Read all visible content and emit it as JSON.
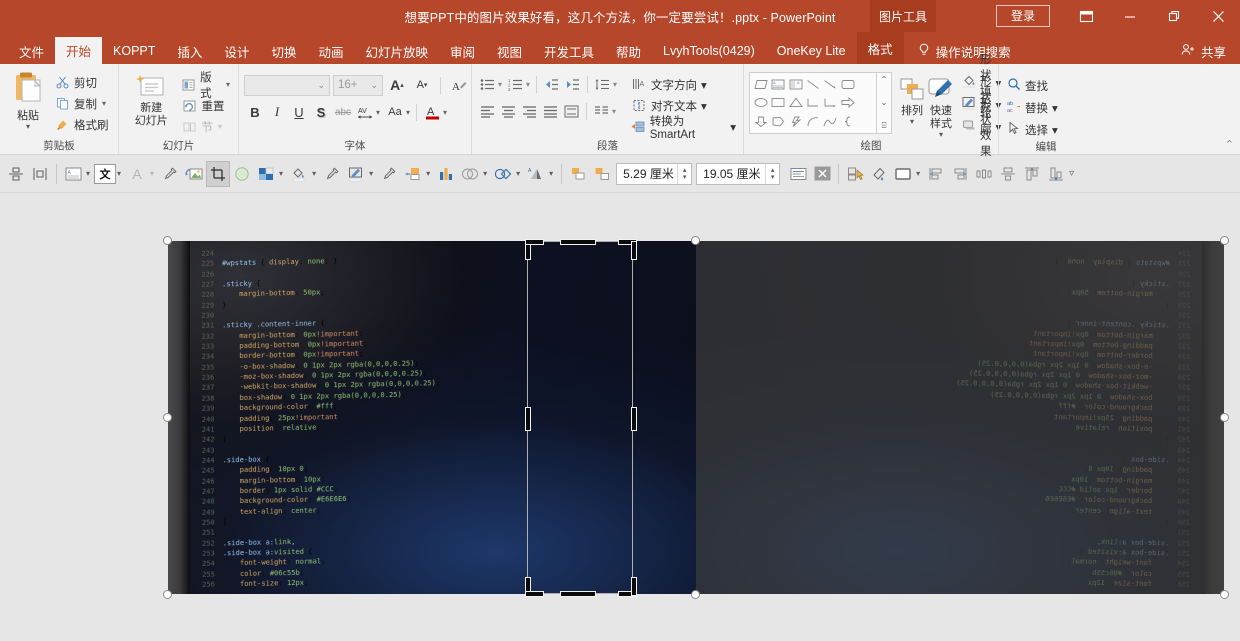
{
  "titlebar": {
    "document_title": "想要PPT中的图片效果好看，这几个方法，你一定要尝试！.pptx  -  PowerPoint",
    "picture_tools_label": "图片工具",
    "signin_label": "登录",
    "ribbon_display_icon": "ribbon-display-options-icon",
    "minimize_label": "—",
    "restore_label": "❐",
    "close_label": "✕"
  },
  "tabs": [
    {
      "label": "文件",
      "state": "normal"
    },
    {
      "label": "开始",
      "state": "active"
    },
    {
      "label": "KOPPT",
      "state": "normal"
    },
    {
      "label": "插入",
      "state": "normal"
    },
    {
      "label": "设计",
      "state": "normal"
    },
    {
      "label": "切换",
      "state": "normal"
    },
    {
      "label": "动画",
      "state": "normal"
    },
    {
      "label": "幻灯片放映",
      "state": "normal"
    },
    {
      "label": "审阅",
      "state": "normal"
    },
    {
      "label": "视图",
      "state": "normal"
    },
    {
      "label": "开发工具",
      "state": "normal"
    },
    {
      "label": "帮助",
      "state": "normal"
    },
    {
      "label": "LvyhTools(0429)",
      "state": "normal"
    },
    {
      "label": "OneKey Lite",
      "state": "normal"
    },
    {
      "label": "格式",
      "state": "contextual"
    }
  ],
  "tellme": {
    "placeholder": "操作说明搜索",
    "icon": "lightbulb-icon"
  },
  "share": {
    "label": "共享",
    "icon": "share-person-icon"
  },
  "ribbon": {
    "groups": [
      {
        "name": "clipboard",
        "title": "剪贴板",
        "paste": {
          "label": "粘贴",
          "icon": "paste-icon"
        },
        "items": [
          {
            "label": "剪切",
            "icon": "scissors-icon",
            "has_dropdown": false
          },
          {
            "label": "复制",
            "icon": "copy-icon",
            "has_dropdown": true
          },
          {
            "label": "格式刷",
            "icon": "format-painter-icon",
            "has_dropdown": false
          }
        ]
      },
      {
        "name": "slides",
        "title": "幻灯片",
        "new_slide": {
          "label": "新建\n幻灯片",
          "icon": "new-slide-icon"
        },
        "items": [
          {
            "label": "版式",
            "icon": "layout-icon",
            "has_dropdown": true,
            "disabled": false
          },
          {
            "label": "重置",
            "icon": "reset-icon",
            "has_dropdown": false,
            "disabled": false
          },
          {
            "label": "节",
            "icon": "section-icon",
            "has_dropdown": true,
            "disabled": true
          }
        ]
      },
      {
        "name": "font",
        "title": "字体",
        "font_name_value": "",
        "font_size_value": "16+",
        "buttons_row1": [
          "grow-font-icon",
          "shrink-font-icon",
          "clear-formatting-icon"
        ],
        "buttons_row2": [
          "bold-icon",
          "italic-icon",
          "underline-icon",
          "shadow-icon",
          "strikethrough-icon",
          "character-spacing-icon",
          "change-case-icon",
          "font-color-icon"
        ]
      },
      {
        "name": "paragraph",
        "title": "段落",
        "row1_icons": [
          "bullets-icon",
          "numbering-icon",
          "decrease-indent-icon",
          "increase-indent-icon",
          "line-spacing-icon"
        ],
        "row2_icons": [
          "align-left-icon",
          "align-center-icon",
          "align-right-icon",
          "justify-icon",
          "columns-icon",
          "text-direction-list-icon"
        ],
        "side_items": [
          {
            "label": "文字方向",
            "icon": "text-direction-icon",
            "has_dropdown": true
          },
          {
            "label": "对齐文本",
            "icon": "align-text-icon",
            "has_dropdown": true
          },
          {
            "label": "转换为 SmartArt",
            "icon": "smartart-icon",
            "has_dropdown": true
          }
        ]
      },
      {
        "name": "drawing",
        "title": "绘图",
        "shapes_gallery_icon": "shapes-gallery",
        "arrange": {
          "label": "排列",
          "icon": "arrange-icon"
        },
        "quick_styles": {
          "label": "快速样式",
          "icon": "quick-styles-icon"
        },
        "side_items": [
          {
            "label": "形状填充",
            "icon": "shape-fill-icon",
            "has_dropdown": true
          },
          {
            "label": "形状轮廓",
            "icon": "shape-outline-icon",
            "has_dropdown": true
          },
          {
            "label": "形状效果",
            "icon": "shape-effects-icon",
            "has_dropdown": true
          }
        ]
      },
      {
        "name": "editing",
        "title": "编辑",
        "items": [
          {
            "label": "查找",
            "icon": "search-icon",
            "has_dropdown": false
          },
          {
            "label": "替换",
            "icon": "replace-icon",
            "has_dropdown": true
          },
          {
            "label": "选择",
            "icon": "select-icon",
            "has_dropdown": true
          }
        ]
      }
    ],
    "collapse_icon": "ribbon-collapse-icon"
  },
  "quick_toolbar": {
    "items": [
      {
        "icon": "align-object-icon",
        "type": "button"
      },
      {
        "icon": "distribute-object-icon",
        "type": "button"
      },
      {
        "icon": "text-box-icon",
        "type": "split"
      },
      {
        "icon": "text-direction-box-icon",
        "type": "split",
        "selected_box": true
      },
      {
        "icon": "font-color-a-icon",
        "type": "split",
        "disabled": true
      },
      {
        "icon": "eyedropper-font-icon",
        "type": "button"
      },
      {
        "icon": "change-picture-icon",
        "type": "button"
      },
      {
        "icon": "crop-icon",
        "type": "button",
        "active": true
      },
      {
        "icon": "shape-circle-icon",
        "type": "button"
      },
      {
        "icon": "picture-styles-icon",
        "type": "split"
      },
      {
        "icon": "shape-fill-bucket-icon",
        "type": "split"
      },
      {
        "icon": "eyedropper-fill-icon",
        "type": "button"
      },
      {
        "icon": "shape-outline-pen-icon",
        "type": "split"
      },
      {
        "icon": "eyedropper-outline-icon",
        "type": "button"
      },
      {
        "icon": "bring-forward-icon",
        "type": "split"
      },
      {
        "icon": "chart-icon",
        "type": "button"
      },
      {
        "icon": "merge-shapes-icon",
        "type": "split"
      },
      {
        "icon": "shape-union-icon",
        "type": "split"
      },
      {
        "icon": "shape-effects-3d-icon",
        "type": "split"
      }
    ],
    "size_height": {
      "value": "5.29 厘米",
      "name": "shape-height"
    },
    "size_width": {
      "value": "19.05 厘米",
      "name": "shape-width"
    },
    "items_right": [
      {
        "icon": "text-align-box-icon",
        "type": "button"
      },
      {
        "icon": "close-x-icon",
        "type": "button",
        "dark": true
      },
      {
        "icon": "selection-pane-icon",
        "type": "button"
      },
      {
        "icon": "format-painter-2-icon",
        "type": "button"
      },
      {
        "icon": "shape-frame-icon",
        "type": "split"
      },
      {
        "icon": "align-left-obj-icon",
        "type": "button"
      },
      {
        "icon": "align-right-obj-icon",
        "type": "button"
      },
      {
        "icon": "distribute-h-icon",
        "type": "button"
      },
      {
        "icon": "align-center-obj-icon",
        "type": "button"
      },
      {
        "icon": "align-top-obj-icon",
        "type": "button"
      },
      {
        "icon": "align-bottom-obj-icon",
        "type": "button"
      },
      {
        "icon": "more-chevron-icon",
        "type": "button"
      }
    ]
  },
  "canvas": {
    "slide_name": "slide-area",
    "image_name": "picture-placeholder-code-screen",
    "crop_mode": true,
    "code_lines": [
      {
        "n": "224",
        "t": ""
      },
      {
        "n": "225",
        "t": "#wpstats { display: none; }"
      },
      {
        "n": "226",
        "t": ""
      },
      {
        "n": "227",
        "t": ".sticky {"
      },
      {
        "n": "228",
        "t": "    margin-bottom: 50px;"
      },
      {
        "n": "229",
        "t": "}"
      },
      {
        "n": "230",
        "t": ""
      },
      {
        "n": "231",
        "t": ".sticky .content-inner {"
      },
      {
        "n": "232",
        "t": "    margin-bottom: 0px!important;"
      },
      {
        "n": "233",
        "t": "    padding-bottom: 0px!important;"
      },
      {
        "n": "234",
        "t": "    border-bottom: 0px!important;"
      },
      {
        "n": "235",
        "t": "    -o-box-shadow: 0 1px 2px rgba(0,0,0,0.25);"
      },
      {
        "n": "236",
        "t": "    -moz-box-shadow: 0 1px 2px rgba(0,0,0,0.25);"
      },
      {
        "n": "237",
        "t": "    -webkit-box-shadow: 0 1px 2px rgba(0,0,0,0.25);"
      },
      {
        "n": "238",
        "t": "    box-shadow: 0 1px 2px rgba(0,0,0,0.25);"
      },
      {
        "n": "239",
        "t": "    background-color: #fff;"
      },
      {
        "n": "240",
        "t": "    padding: 25px!important;"
      },
      {
        "n": "241",
        "t": "    position: relative;"
      },
      {
        "n": "242",
        "t": "}"
      },
      {
        "n": "243",
        "t": ""
      },
      {
        "n": "244",
        "t": ".side-box {"
      },
      {
        "n": "245",
        "t": "    padding: 10px 0;"
      },
      {
        "n": "246",
        "t": "    margin-bottom: 10px;"
      },
      {
        "n": "247",
        "t": "    border: 1px solid #CCC;"
      },
      {
        "n": "248",
        "t": "    background-color: #E6E6E6;"
      },
      {
        "n": "249",
        "t": "    text-align: center;"
      },
      {
        "n": "250",
        "t": "}"
      },
      {
        "n": "251",
        "t": ""
      },
      {
        "n": "252",
        "t": ".side-box a:link,"
      },
      {
        "n": "253",
        "t": ".side-box a:visited {"
      },
      {
        "n": "254",
        "t": "    font-weight: normal;"
      },
      {
        "n": "255",
        "t": "    color: #06c55b;"
      },
      {
        "n": "256",
        "t": "    font-size: 12px;"
      }
    ]
  },
  "colors": {
    "accent": "#b7472a",
    "contextual_tab": "#a83c1f",
    "ribbon_bg": "#f2f2f2",
    "app_bg": "#e6e6e6",
    "toolbar_bg": "#e6e6e6"
  }
}
